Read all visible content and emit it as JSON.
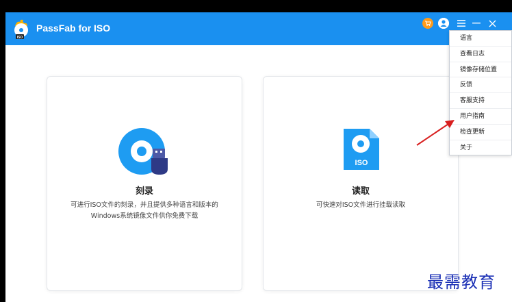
{
  "window": {
    "title": "PassFab for ISO"
  },
  "icons": {
    "logo": "passfab-iso-logo-icon",
    "cart": "cart-icon",
    "user": "user-icon",
    "menu": "hamburger-menu-icon",
    "minimize": "minimize-icon",
    "close": "close-icon"
  },
  "cards": [
    {
      "title": "刻录",
      "description_lines": [
        "可进行ISO文件的刻录，并且提供多种语言和版本的",
        "Windows系统镜像文件供你免费下载"
      ],
      "icon": "disc-usb-icon"
    },
    {
      "title": "读取",
      "description_lines": [
        "可快速对ISO文件进行挂载读取"
      ],
      "icon": "iso-file-icon",
      "icon_label": "ISO"
    }
  ],
  "menu": {
    "items": [
      {
        "label": "语言"
      },
      {
        "label": "查看日志"
      },
      {
        "label": "镜像存储位置"
      },
      {
        "label": "反馈"
      },
      {
        "label": "客服支持"
      },
      {
        "label": "用户指南"
      },
      {
        "label": "检查更新"
      },
      {
        "label": "关于"
      }
    ]
  },
  "watermark": "最需教育",
  "colors": {
    "titlebar": "#1a90f0",
    "accent": "#1a90f0",
    "cart": "#ff9b1a",
    "annotation_arrow": "#d81e1e",
    "watermark": "#1a2fb5"
  }
}
